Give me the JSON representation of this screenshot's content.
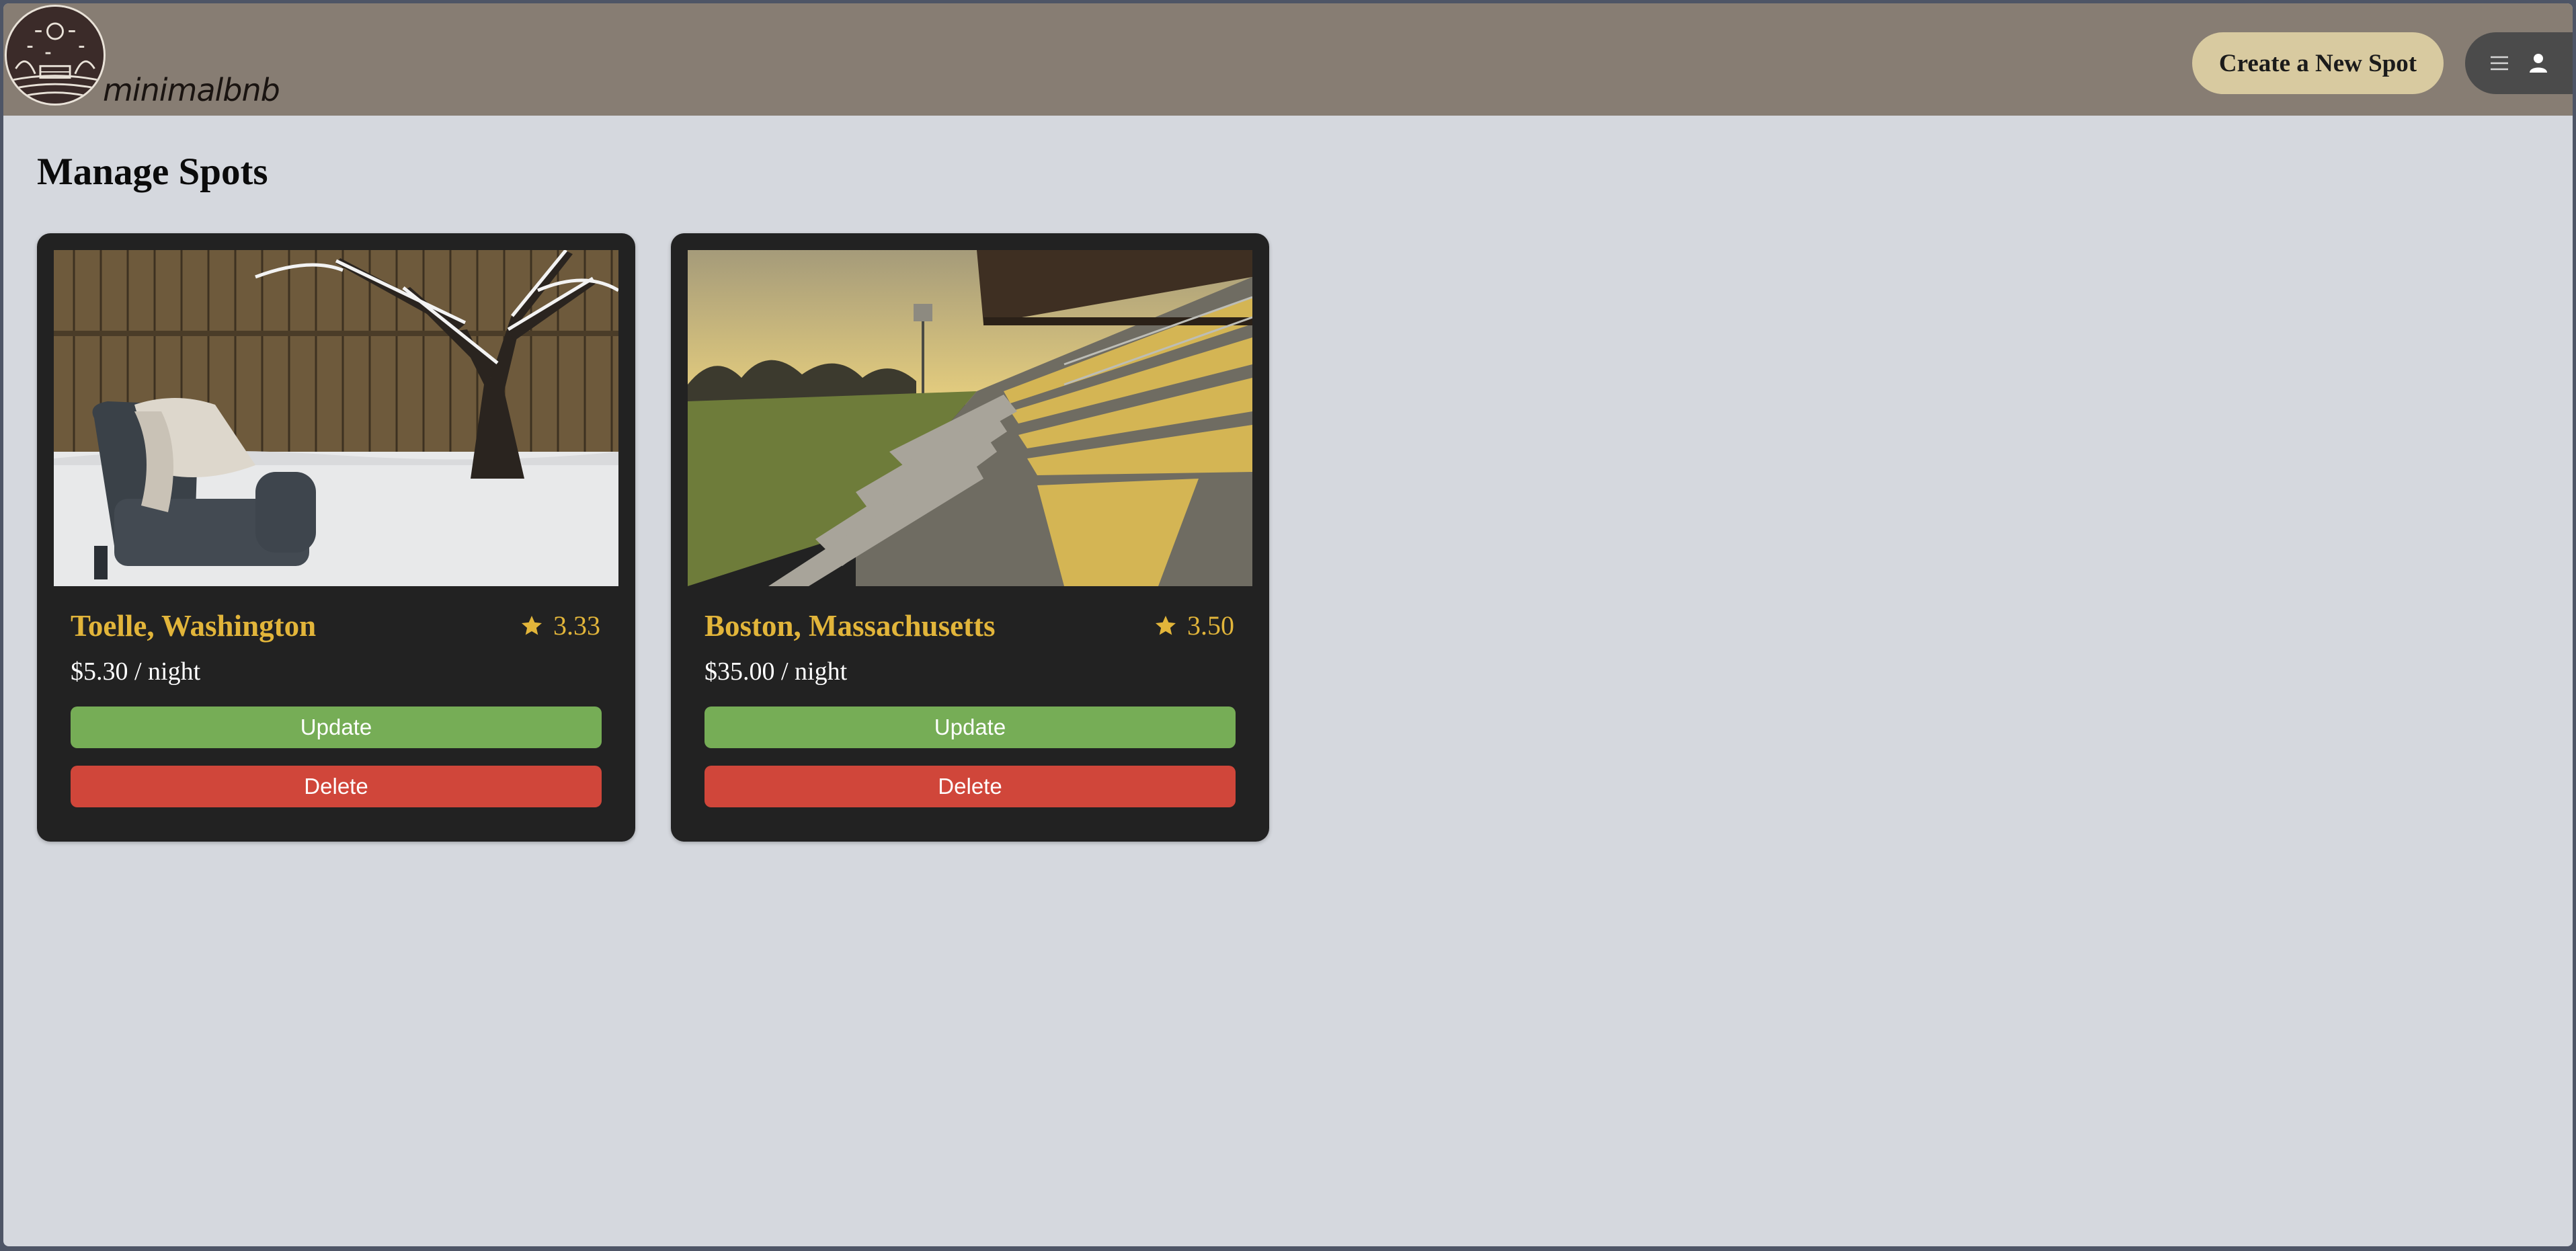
{
  "header": {
    "brand": "minimalbnb",
    "create_label": "Create a New Spot",
    "menu_icon": "hamburger-icon",
    "user_icon": "user-icon"
  },
  "page": {
    "title": "Manage Spots"
  },
  "spots": [
    {
      "title": "Toelle, Washington",
      "rating": "3.33",
      "price": "$5.30 / night",
      "update_label": "Update",
      "delete_label": "Delete"
    },
    {
      "title": "Boston, Massachusetts",
      "rating": "3.50",
      "price": "$35.00 / night",
      "update_label": "Update",
      "delete_label": "Delete"
    }
  ],
  "colors": {
    "header": "#877d73",
    "background": "#d5d8de",
    "card": "#222222",
    "accent_gold": "#e2b53a",
    "update_green": "#76ad56",
    "delete_red": "#d0463a",
    "create_button": "#d8caa0"
  }
}
